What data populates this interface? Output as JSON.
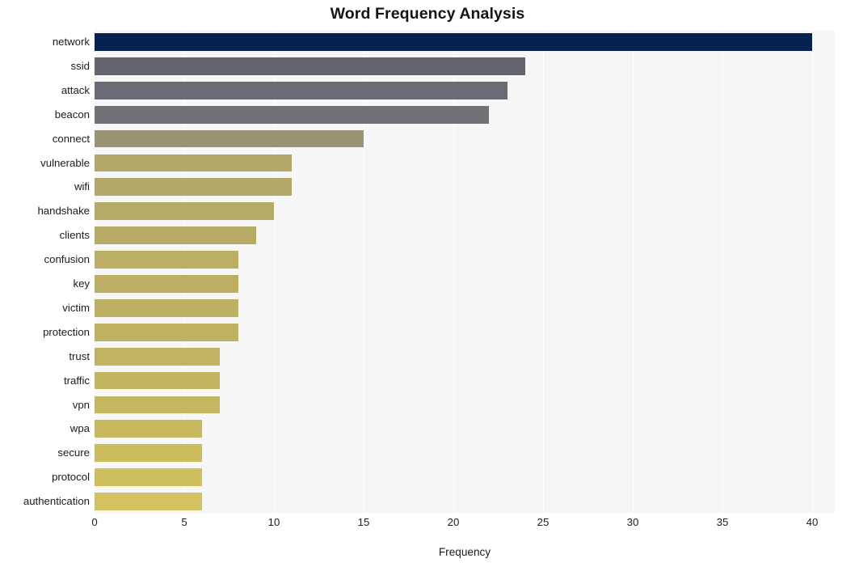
{
  "chart_data": {
    "type": "bar",
    "orientation": "horizontal",
    "title": "Word Frequency Analysis",
    "xlabel": "Frequency",
    "ylabel": "",
    "categories": [
      "network",
      "ssid",
      "attack",
      "beacon",
      "connect",
      "vulnerable",
      "wifi",
      "handshake",
      "clients",
      "confusion",
      "key",
      "victim",
      "protection",
      "trust",
      "traffic",
      "vpn",
      "wpa",
      "secure",
      "protocol",
      "authentication"
    ],
    "values": [
      40,
      24,
      23,
      22,
      15,
      11,
      11,
      10,
      9,
      8,
      8,
      8,
      8,
      7,
      7,
      7,
      6,
      6,
      6,
      6
    ],
    "bar_colors": [
      "#04234f",
      "#62656d",
      "#696c74",
      "#717277",
      "#9a9374",
      "#b3a76a",
      "#b4a869",
      "#b6aa68",
      "#b8ab66",
      "#bbae65",
      "#bcaf64",
      "#bdb063",
      "#bfb162",
      "#c1b361",
      "#c3b560",
      "#c5b75f",
      "#c8b95e",
      "#cbbc5e",
      "#cfbf5e",
      "#d3c25f"
    ],
    "xlim": [
      0,
      40
    ],
    "ylim_count": 20,
    "xticks": [
      0,
      5,
      10,
      15,
      20,
      25,
      30,
      35,
      40
    ],
    "xticklabels": [
      "0",
      "5",
      "10",
      "15",
      "20",
      "25",
      "30",
      "35",
      "40"
    ],
    "grid": true,
    "grid_axis": "x",
    "grid_color": "#ffffff",
    "plot_background": "#f7f7f7",
    "figure_background": "#ffffff",
    "legend": null
  }
}
